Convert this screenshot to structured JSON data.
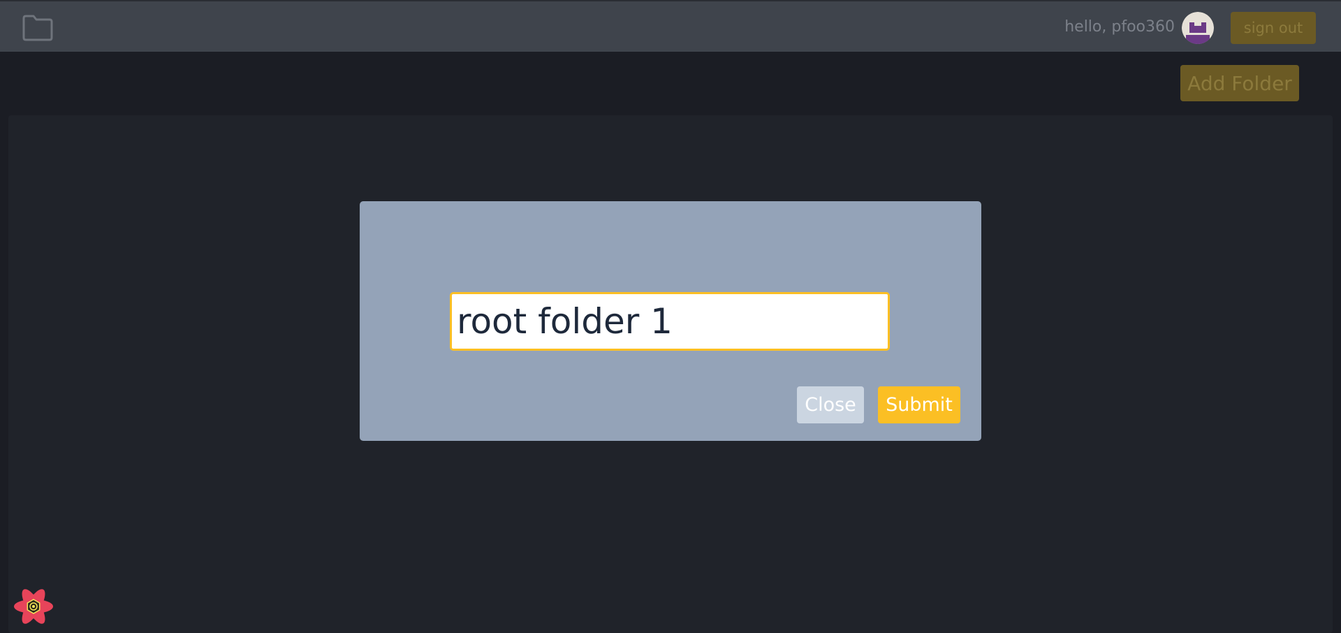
{
  "navbar": {
    "home_icon": "folder-icon",
    "greeting": "hello, pfoo360",
    "avatar_icon": "user-avatar",
    "signout_label": "sign out"
  },
  "toolbar": {
    "add_folder_label": "Add Folder"
  },
  "modal": {
    "input_value": "root folder 1",
    "close_label": "Close",
    "submit_label": "Submit"
  },
  "corner": {
    "logo_icon": "react-devtools-logo"
  },
  "colors": {
    "navbar_bg": "#3f444c",
    "page_bg": "#1b1d24",
    "panel_bg": "#20232a",
    "modal_bg": "#94a3b8",
    "accent": "#fbbf24",
    "accent_dimmed": "#6b5a24",
    "close_bg": "#cbd5e1"
  }
}
